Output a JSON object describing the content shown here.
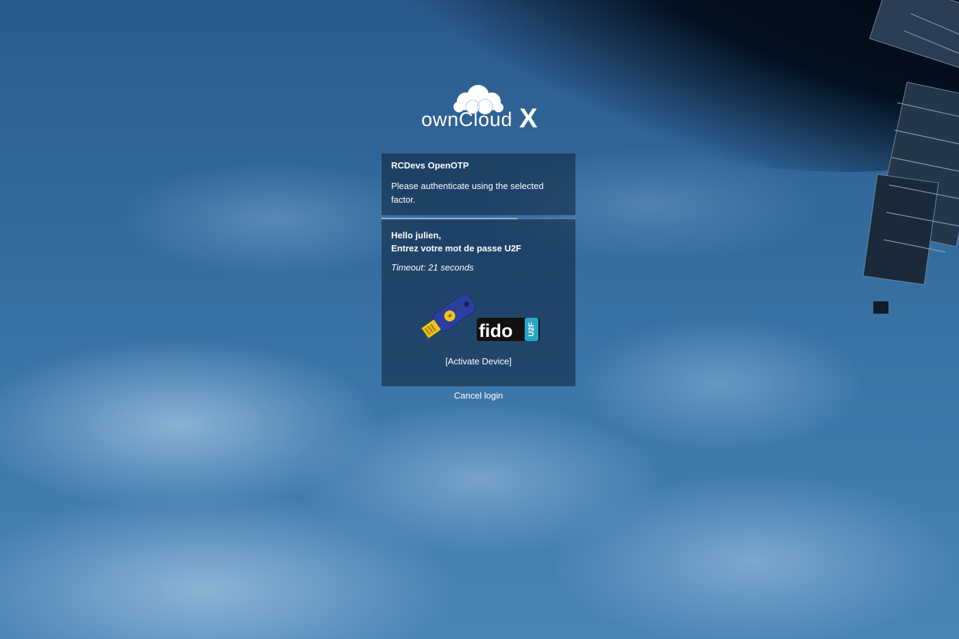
{
  "brand": {
    "logo_name": "ownCloud",
    "logo_suffix": "X"
  },
  "info_panel": {
    "title": "RCDevs OpenOTP",
    "message": "Please authenticate using the selected factor."
  },
  "progress": {
    "fraction": 0.7
  },
  "auth_panel": {
    "greeting_line1": "Hello julien,",
    "greeting_line2": "Entrez votre mot de passe U2F",
    "timeout": "Timeout: 21 seconds",
    "fido_label": "fido",
    "u2f_label": "U2F",
    "activate_label": "[Activate Device]"
  },
  "cancel_label": "Cancel login",
  "colors": {
    "panel": "#122a46",
    "key_blue": "#2b3f9e",
    "key_gold": "#f0c419",
    "u2f_teal": "#2aa6c8"
  },
  "icons": [
    "cloud-logo-icon",
    "security-key-icon",
    "fido-u2f-logo-icon"
  ]
}
